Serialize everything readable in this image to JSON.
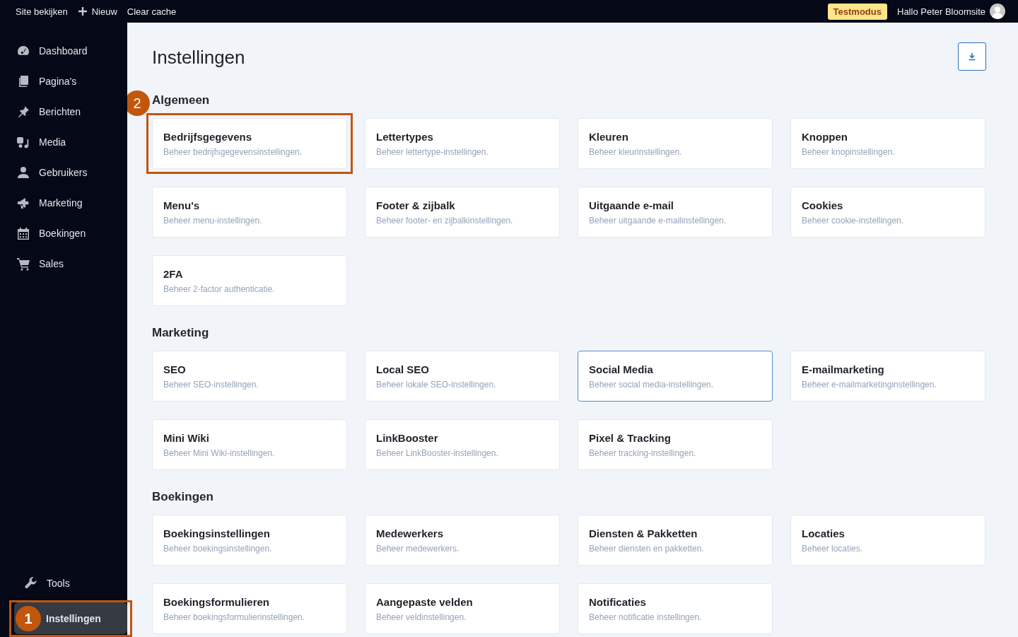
{
  "topbar": {
    "links": [
      {
        "label": "Site bekijken",
        "kind": "plain"
      },
      {
        "label": "Nieuw",
        "kind": "add"
      },
      {
        "label": "Clear cache",
        "kind": "plain"
      }
    ],
    "badge": "Testmodus",
    "greeting": "Hallo Peter Bloomsite"
  },
  "sidebar": {
    "items": [
      {
        "label": "Dashboard",
        "selected": false
      },
      {
        "label": "Pagina's",
        "selected": false
      },
      {
        "label": "Berichten",
        "selected": false
      },
      {
        "label": "Media",
        "selected": false
      },
      {
        "label": "Gebruikers",
        "selected": false
      },
      {
        "label": "Marketing",
        "selected": false
      },
      {
        "label": "Boekingen",
        "selected": false
      },
      {
        "label": "Sales",
        "selected": false
      }
    ],
    "bottom_items": [
      {
        "label": "Tools",
        "selected": false
      },
      {
        "label": "Instellingen",
        "selected": true,
        "callout": "1"
      }
    ]
  },
  "page": {
    "title": "Instellingen",
    "sections": [
      {
        "title": "Algemeen",
        "cards": [
          {
            "title": "Bedrijfsgegevens",
            "description": "Beheer bedrijfsgegevensinstellingen.",
            "focused": false,
            "callout": "2"
          },
          {
            "title": "Lettertypes",
            "description": "Beheer lettertype-instellingen.",
            "focused": false
          },
          {
            "title": "Kleuren",
            "description": "Beheer kleurinstellingen.",
            "focused": false
          },
          {
            "title": "Knoppen",
            "description": "Beheer knopinstellingen.",
            "focused": false
          },
          {
            "title": "Menu's",
            "description": "Beheer menu-instellingen.",
            "focused": false
          },
          {
            "title": "Footer & zijbalk",
            "description": "Beheer footer- en zijbalkinstellingen.",
            "focused": false
          },
          {
            "title": "Uitgaande e-mail",
            "description": "Beheer uitgaande e-mailinstellingen.",
            "focused": false
          },
          {
            "title": "Cookies",
            "description": "Beheer cookie-instellingen.",
            "focused": false
          },
          {
            "title": "2FA",
            "description": "Beheer 2-factor authenticatie.",
            "focused": false
          }
        ]
      },
      {
        "title": "Marketing",
        "cards": [
          {
            "title": "SEO",
            "description": "Beheer SEO-instellingen.",
            "focused": false
          },
          {
            "title": "Local SEO",
            "description": "Beheer lokale SEO-instellingen.",
            "focused": false
          },
          {
            "title": "Social Media",
            "description": "Beheer social media-instellingen.",
            "focused": true
          },
          {
            "title": "E-mailmarketing",
            "description": "Beheer e-mailmarketinginstellingen.",
            "focused": false
          },
          {
            "title": "Mini Wiki",
            "description": "Beheer Mini Wiki-instellingen.",
            "focused": false
          },
          {
            "title": "LinkBooster",
            "description": "Beheer LinkBooster-instellingen.",
            "focused": false
          },
          {
            "title": "Pixel & Tracking",
            "description": "Beheer tracking-instellingen.",
            "focused": false
          }
        ]
      },
      {
        "title": "Boekingen",
        "cards": [
          {
            "title": "Boekingsinstellingen",
            "description": "Beheer boekingsinstellingen.",
            "focused": false
          },
          {
            "title": "Medewerkers",
            "description": "Beheer medewerkers.",
            "focused": false
          },
          {
            "title": "Diensten & Pakketten",
            "description": "Beheer diensten en pakketten.",
            "focused": false
          },
          {
            "title": "Locaties",
            "description": "Beheer locaties.",
            "focused": false
          },
          {
            "title": "Boekingsformulieren",
            "description": "Beheer boekingsformulierinstellingen.",
            "focused": false
          },
          {
            "title": "Aangepaste velden",
            "description": "Beheer veldinstellingen.",
            "focused": false
          },
          {
            "title": "Notificaties",
            "description": "Beheer notificatie instellingen.",
            "focused": false
          }
        ]
      }
    ]
  }
}
